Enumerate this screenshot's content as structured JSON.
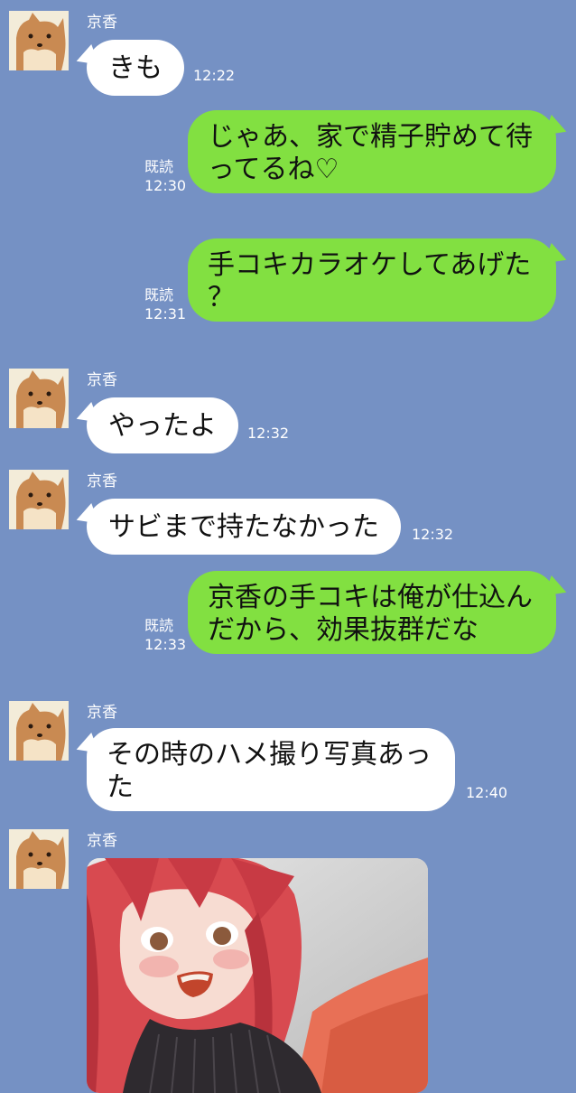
{
  "colors": {
    "background": "#7591c4",
    "incoming_bubble": "#ffffff",
    "outgoing_bubble": "#82e041",
    "meta_text": "#ffffff"
  },
  "messages": [
    {
      "sender": "京香",
      "text": "きも",
      "time": "12:22"
    },
    {
      "read_label": "既読",
      "time": "12:30",
      "text_line1": "じゃあ、家で精子貯めて待",
      "text_line2": "ってるね♡"
    },
    {
      "read_label": "既読",
      "time": "12:31",
      "text_line1": "手コキカラオケしてあげた",
      "text_line2": "？"
    },
    {
      "sender": "京香",
      "text": "やったよ",
      "time": "12:32"
    },
    {
      "sender": "京香",
      "text": "サビまで持たなかった",
      "time": "12:32"
    },
    {
      "read_label": "既読",
      "time": "12:33",
      "text_line1": "京香の手コキは俺が仕込ん",
      "text_line2": "だから、効果抜群だな"
    },
    {
      "sender": "京香",
      "text_line1": "その時のハメ撮り写真あっ",
      "text_line2": "た",
      "time": "12:40"
    },
    {
      "sender": "京香",
      "image": "anime-girl-photo"
    }
  ]
}
